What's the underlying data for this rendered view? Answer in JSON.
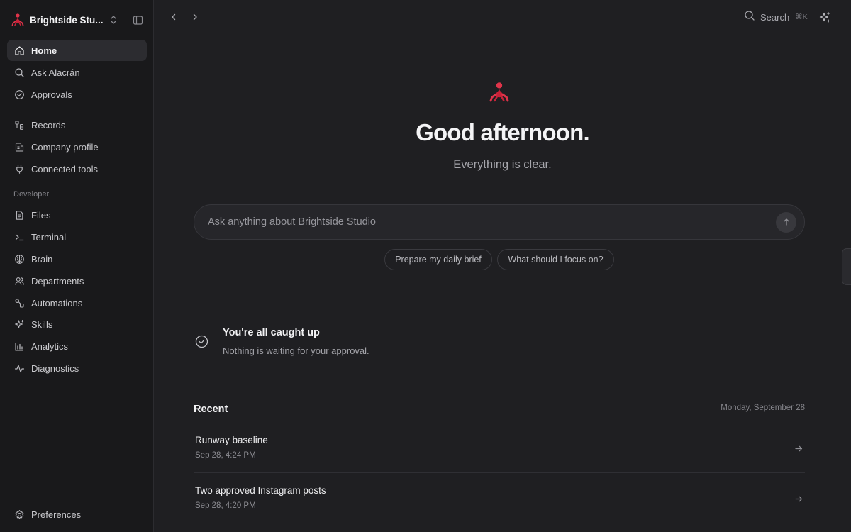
{
  "workspace": {
    "name": "Brightside Stu..."
  },
  "sidebar": {
    "primary": [
      {
        "label": "Home",
        "icon": "home-icon",
        "active": true
      },
      {
        "label": "Ask Alacrán",
        "icon": "search-icon"
      },
      {
        "label": "Approvals",
        "icon": "check-circle-icon"
      }
    ],
    "secondary": [
      {
        "label": "Records",
        "icon": "records-icon"
      },
      {
        "label": "Company profile",
        "icon": "building-icon"
      },
      {
        "label": "Connected tools",
        "icon": "plug-icon"
      }
    ],
    "developer_label": "Developer",
    "developer": [
      {
        "label": "Files",
        "icon": "file-icon"
      },
      {
        "label": "Terminal",
        "icon": "terminal-icon"
      },
      {
        "label": "Brain",
        "icon": "brain-icon"
      },
      {
        "label": "Departments",
        "icon": "users-icon"
      },
      {
        "label": "Automations",
        "icon": "workflow-icon"
      },
      {
        "label": "Skills",
        "icon": "sparkles-icon"
      },
      {
        "label": "Analytics",
        "icon": "bar-chart-icon"
      },
      {
        "label": "Diagnostics",
        "icon": "activity-icon"
      }
    ],
    "footer": {
      "label": "Preferences",
      "icon": "gear-icon"
    }
  },
  "topbar": {
    "search_label": "Search",
    "search_shortcut": "⌘K"
  },
  "hero": {
    "greeting": "Good afternoon.",
    "subtitle": "Everything is clear."
  },
  "ask": {
    "placeholder": "Ask anything about Brightside Studio",
    "suggestions": [
      "Prepare my daily brief",
      "What should I focus on?"
    ]
  },
  "approvals": {
    "title": "You're all caught up",
    "subtitle": "Nothing is waiting for your approval."
  },
  "recent": {
    "title": "Recent",
    "date": "Monday, September 28",
    "items": [
      {
        "title": "Runway baseline",
        "time": "Sep 28, 4:24 PM"
      },
      {
        "title": "Two approved Instagram posts",
        "time": "Sep 28, 4:20 PM"
      }
    ]
  },
  "colors": {
    "background": "#1f1f22",
    "sidebar": "#19191b",
    "brand_red": "#d92b3f",
    "active_item": "#2c2c30"
  }
}
